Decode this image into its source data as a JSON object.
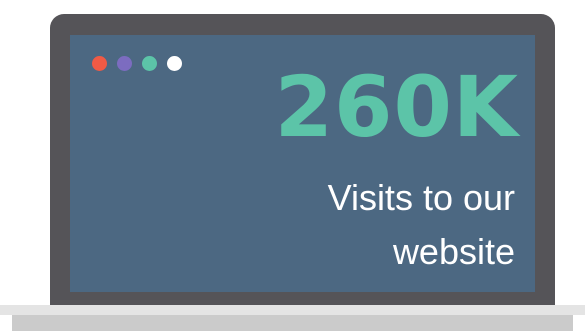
{
  "colors": {
    "bezel": "#555458",
    "screen": "#4c6882",
    "accent": "#5cc4a8",
    "base_top": "#e4e4e4",
    "base_bottom": "#cbcbcb"
  },
  "window_dots": [
    {
      "name": "red-dot",
      "color": "#f05a45"
    },
    {
      "name": "purple-dot",
      "color": "#7c6cc0"
    },
    {
      "name": "teal-dot",
      "color": "#5cc4a8"
    },
    {
      "name": "white-dot",
      "color": "#ffffff"
    }
  ],
  "stat": {
    "value": "260K",
    "caption_line_1": "Visits to our",
    "caption_line_2": "website"
  }
}
